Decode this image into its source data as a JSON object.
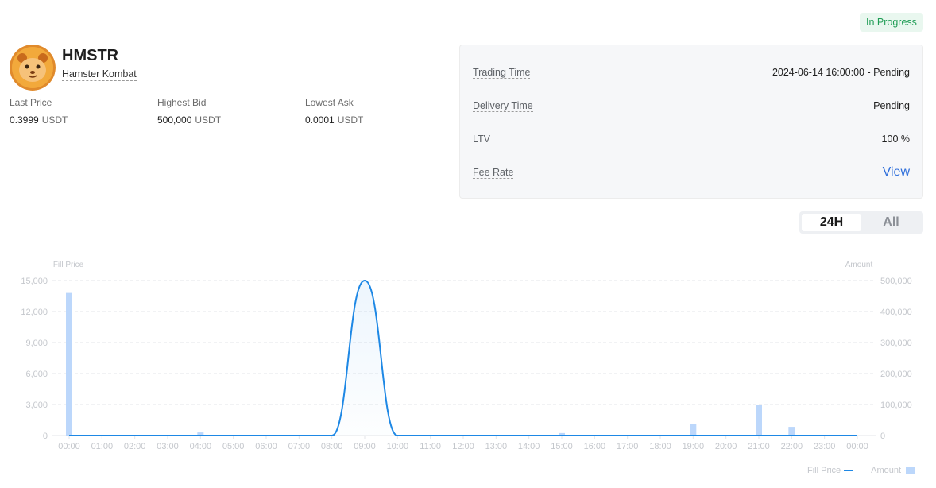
{
  "status": "In Progress",
  "asset": {
    "symbol": "HMSTR",
    "name": "Hamster Kombat"
  },
  "stats": [
    {
      "label": "Last Price",
      "value": "0.3999",
      "unit": "USDT"
    },
    {
      "label": "Highest Bid",
      "value": "500,000",
      "unit": "USDT"
    },
    {
      "label": "Lowest Ask",
      "value": "0.0001",
      "unit": "USDT"
    }
  ],
  "info": [
    {
      "label": "Trading Time",
      "value": "2024-06-14 16:00:00 - Pending"
    },
    {
      "label": "Delivery Time",
      "value": "Pending"
    },
    {
      "label": "LTV",
      "value": "100 %"
    },
    {
      "label": "Fee Rate",
      "value": "View"
    }
  ],
  "range": {
    "options": [
      "24H",
      "All"
    ],
    "selected": "24H"
  },
  "colors": {
    "line": "#1e88e5",
    "bar": "#bcd7fb",
    "grid": "#e3e5e8",
    "badge_text": "#1f9d55",
    "link": "#2f6fdb"
  },
  "chart_data": {
    "type": "bar+line",
    "x": [
      "00:00",
      "01:00",
      "02:00",
      "03:00",
      "04:00",
      "05:00",
      "06:00",
      "07:00",
      "08:00",
      "09:00",
      "10:00",
      "11:00",
      "12:00",
      "13:00",
      "14:00",
      "15:00",
      "16:00",
      "17:00",
      "18:00",
      "19:00",
      "20:00",
      "21:00",
      "22:00",
      "23:00",
      "00:00"
    ],
    "y_left": {
      "label": "Fill Price",
      "ticks": [
        "0",
        "3,000",
        "6,000",
        "9,000",
        "12,000",
        "15,000"
      ],
      "range": [
        0,
        15000
      ]
    },
    "y_right": {
      "label": "Amount",
      "ticks": [
        "0",
        "100,000",
        "200,000",
        "300,000",
        "400,000",
        "500,000"
      ],
      "range": [
        0,
        500000
      ]
    },
    "grid": true,
    "legend": {
      "position": "bottom-right",
      "entries": [
        "Fill Price",
        "Amount"
      ]
    },
    "series": [
      {
        "name": "Fill Price",
        "kind": "line",
        "values": [
          0,
          0,
          0,
          0,
          0,
          0,
          0,
          0,
          0,
          15000,
          0,
          0,
          0,
          0,
          0,
          0,
          0,
          0,
          0,
          0,
          0,
          0,
          0,
          0,
          0
        ]
      },
      {
        "name": "Amount",
        "kind": "bar",
        "values": [
          460000,
          0,
          0,
          0,
          10000,
          0,
          0,
          0,
          0,
          0,
          0,
          0,
          0,
          0,
          0,
          8000,
          0,
          0,
          0,
          38000,
          0,
          100000,
          28000,
          0,
          0
        ]
      }
    ]
  }
}
